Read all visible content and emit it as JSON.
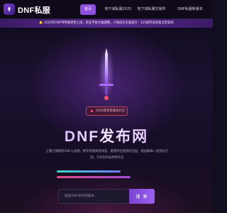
{
  "header": {
    "logo_text": "DNF私服",
    "nav": [
      {
        "label": "首页",
        "active": true
      },
      {
        "label": "地下城私服2025",
        "active": false
      },
      {
        "label": "地下城私服交易所",
        "active": false
      },
      {
        "label": "DNF私服新版本",
        "active": false
      }
    ]
  },
  "notice": {
    "text": "🔔 2026年DNF神界版更新上线，职业平衡大幅调整，人物成长全面提升 · 125级传说装备全新登场"
  },
  "hero": {
    "badge": "2026新年新版本开启",
    "title": "DNF发布网",
    "description": "汇聚全网最新DNF公益服，畅享原版爽快体验，重燃阿拉德冒险热血，挑战巅峰一起组队打团，今年的目标神界开启"
  },
  "search": {
    "placeholder": "搜索DNF发布网版本...",
    "button_label": "搜 索"
  },
  "colors": {
    "accent": "#8f4fe0",
    "badge": "#b4495d",
    "bar_cyan": "#3fd6c8",
    "bar_pink": "#e24b8a"
  }
}
